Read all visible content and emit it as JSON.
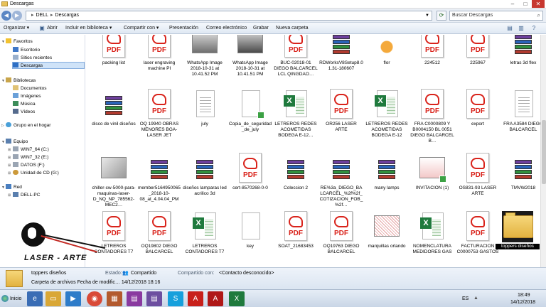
{
  "window": {
    "title": "Descargas",
    "minimize": "–",
    "maximize": "□",
    "close": "✕"
  },
  "address": {
    "back": "◀",
    "forward": "▶",
    "crumbs": [
      "DELL",
      "Descargas"
    ],
    "crumb_sep": "▸",
    "refresh": "⟳",
    "search_placeholder": "Buscar Descargas"
  },
  "toolbar": {
    "organize": "Organizar ▾",
    "open": "Abrir",
    "include": "Incluir en biblioteca ▾",
    "share": "Compartir con ▾",
    "slideshow": "Presentación",
    "email": "Correo electrónico",
    "burn": "Grabar",
    "new_folder": "Nueva carpeta"
  },
  "sidebar": {
    "favorites": "Favoritos",
    "desktop": "Escritorio",
    "recent": "Sitios recientes",
    "downloads": "Descargas",
    "libraries": "Bibliotecas",
    "documents": "Documentos",
    "images": "Imágenes",
    "music": "Música",
    "videos": "Vídeos",
    "homegroup": "Grupo en el hogar",
    "computer": "Equipo",
    "drive_c": "WIN7_64 (C:)",
    "drive_e": "WIN7_32 (E:)",
    "drive_f": "DATOS (F:)",
    "drive_g": "Unidad de CD (G:)",
    "network": "Red",
    "pc": "DELL-PC"
  },
  "files": {
    "r1": [
      "packing list",
      "laser engraving machine PI",
      "WhatsApp Image 2018-10-31 at 10.41.52 PM",
      "WhatsApp Image 2018-10-31 at 10.41.51 PM",
      "BUC-02018-01 DIEGO BALCARCEL LCL QINGDAO…",
      "RDWorksV8Setup8.01.31-180607",
      "flor",
      "224512",
      "225967",
      "letras 3d flex"
    ],
    "r2": [
      "disco de vinil diseños",
      "OQ 19940 OBRAS MENORES BGA-LASER JET",
      "july",
      "Copia_de_seguridad_de_july",
      "LETREROS REDES ACOMETIDAS BODEGA E-12…",
      "OR256 LASER ARTE",
      "LETREROS REDES ACOMETIDAS BODEGA E-12",
      "FRA C0000809 Y B0004150 BL 0051 DIEGO BALCARCEL B…",
      "export",
      "FRA A3584 DIEGO BALCARCEL"
    ],
    "r3": [
      "chiller-cw-5000-para-maquinas-laser-D_NQ_NP_785562-MEC2…",
      "member5164950065_2018-10-08_at_4.04.04_PM",
      "diseños lamparas led acrilico 3d",
      "cert-8570268-0-0",
      "Coleccion 2",
      "RE%3a_DIEGO_BALCARCEL_%2f%2f_COTIZACION_FOB_%2f…",
      "many lamps",
      "INVITACION (1)",
      "OS831-93 LASER ARTE",
      "TMVW2018"
    ],
    "r4": [
      "LETREROS CONTADORES T7",
      "OQ19802 DIEGO BALCARCEL",
      "LETREROS CONTADORES T7",
      "key",
      "SOAT_21683453",
      "OQ19763 DIEGO BALCARCEL",
      "marquillas orlando",
      "NOMENCLATURA MEDIDORES GAS",
      "FACTURACION C0000753 GASTOS",
      "toppers diseños"
    ]
  },
  "details": {
    "name": "toppers diseños",
    "state_label": "Estado:",
    "state_value": "Compartido",
    "shared_label": "Compartido con:",
    "shared_value": "<Contacto desconocido>",
    "type_line": "Carpeta de archivos Fecha de modific… 14/12/2018 18:16"
  },
  "taskbar": {
    "start": "Inicio",
    "lang": "ES",
    "time": "18:49",
    "date": "14/12/2018"
  },
  "logo": {
    "wordmark": "LASER - ARTE"
  },
  "colors": {
    "pdf_red": "#d9231b",
    "excel_green": "#1f7a3d",
    "selection": "#cfe3f8",
    "folder": "#e2b240"
  }
}
